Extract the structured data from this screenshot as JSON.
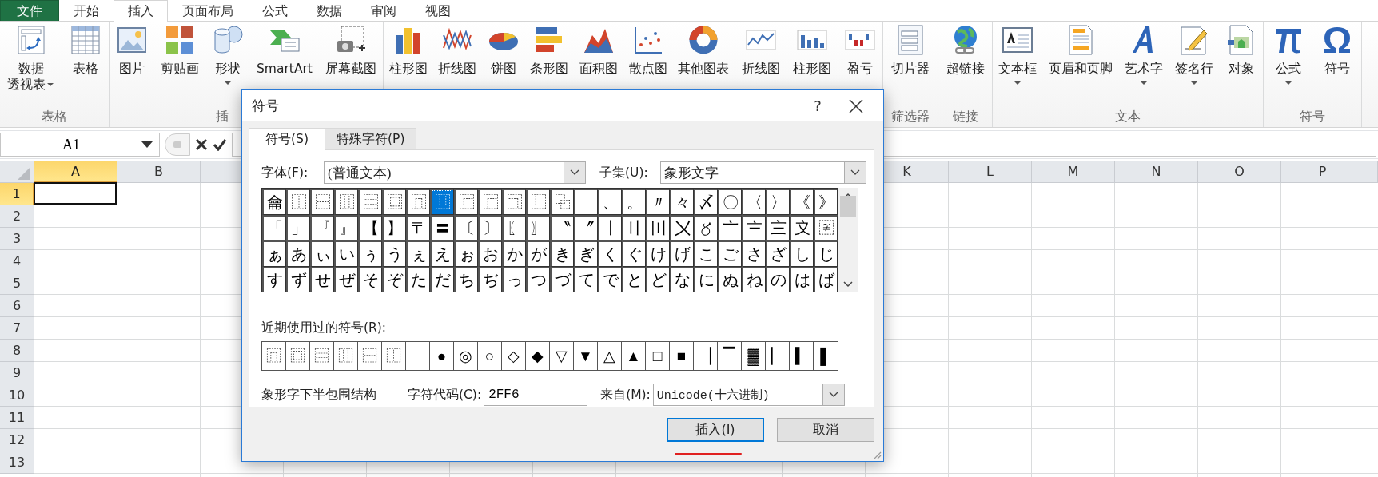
{
  "menu_tabs": [
    {
      "label": "文件",
      "kind": "file",
      "selected": false
    },
    {
      "label": "开始",
      "kind": "tab",
      "selected": false
    },
    {
      "label": "插入",
      "kind": "tab",
      "selected": true
    },
    {
      "label": "页面布局",
      "kind": "tab",
      "selected": false
    },
    {
      "label": "公式",
      "kind": "tab",
      "selected": false
    },
    {
      "label": "数据",
      "kind": "tab",
      "selected": false
    },
    {
      "label": "审阅",
      "kind": "tab",
      "selected": false
    },
    {
      "label": "视图",
      "kind": "tab",
      "selected": false
    }
  ],
  "ribbon": {
    "groups": [
      {
        "label": "表格",
        "buttons": [
          {
            "lines": [
              "数据",
              "透视表"
            ],
            "dropdown": true
          },
          {
            "label": "表格",
            "dropdown": false
          }
        ]
      },
      {
        "label": "插",
        "buttons": [
          {
            "label": "图片",
            "dropdown": false
          },
          {
            "label": "剪贴画",
            "dropdown": false
          },
          {
            "label": "形状",
            "dropdown": true
          },
          {
            "label": "SmartArt",
            "dropdown": false
          },
          {
            "label": "屏幕截图",
            "dropdown": false
          }
        ]
      },
      {
        "buttons": [
          {
            "label": "柱形图",
            "dropdown": false
          },
          {
            "label": "折线图",
            "dropdown": false
          },
          {
            "label": "饼图",
            "dropdown": false
          },
          {
            "label": "条形图",
            "dropdown": false
          },
          {
            "label": "面积图",
            "dropdown": false
          },
          {
            "label": "散点图",
            "dropdown": false
          },
          {
            "label": "其他图表",
            "dropdown": false
          }
        ]
      },
      {
        "buttons": [
          {
            "label": "折线图",
            "dropdown": false
          },
          {
            "label": "柱形图",
            "dropdown": false
          },
          {
            "label": "盈亏",
            "dropdown": false
          }
        ]
      },
      {
        "label": "筛选器",
        "buttons": [
          {
            "label": "切片器",
            "dropdown": false
          }
        ]
      },
      {
        "label": "链接",
        "buttons": [
          {
            "label": "超链接",
            "dropdown": false
          }
        ]
      },
      {
        "label": "文本",
        "buttons": [
          {
            "label": "文本框",
            "dropdown": true
          },
          {
            "label": "页眉和页脚",
            "dropdown": false
          },
          {
            "label": "艺术字",
            "dropdown": true
          },
          {
            "label": "签名行",
            "dropdown": true
          },
          {
            "label": "对象",
            "dropdown": false
          }
        ]
      },
      {
        "label": "符号",
        "buttons": [
          {
            "label": "公式",
            "dropdown": true
          },
          {
            "label": "符号",
            "dropdown": false
          }
        ]
      }
    ]
  },
  "formula_bar": {
    "name_box": "A1"
  },
  "sheet": {
    "columns": [
      {
        "label": "A",
        "selected": true
      },
      {
        "label": "B",
        "selected": false
      },
      {
        "label": "K",
        "selected": false
      },
      {
        "label": "L",
        "selected": false
      },
      {
        "label": "M",
        "selected": false
      },
      {
        "label": "N",
        "selected": false
      },
      {
        "label": "O",
        "selected": false
      },
      {
        "label": "P",
        "selected": false
      }
    ],
    "rows": [
      {
        "label": "1",
        "selected": true
      },
      {
        "label": "2",
        "selected": false
      },
      {
        "label": "3",
        "selected": false
      },
      {
        "label": "4",
        "selected": false
      },
      {
        "label": "5",
        "selected": false
      },
      {
        "label": "6",
        "selected": false
      },
      {
        "label": "7",
        "selected": false
      },
      {
        "label": "8",
        "selected": false
      },
      {
        "label": "9",
        "selected": false
      },
      {
        "label": "10",
        "selected": false
      },
      {
        "label": "11",
        "selected": false
      },
      {
        "label": "12",
        "selected": false
      },
      {
        "label": "13",
        "selected": false
      }
    ]
  },
  "dialog": {
    "title": "符号",
    "help": "?",
    "tabs": [
      {
        "label": "符号(S)",
        "selected": true
      },
      {
        "label": "特殊字符(P)",
        "selected": false
      }
    ],
    "font_label": "字体(F):",
    "font_value": "(普通文本)",
    "subset_label": "子集(U):",
    "subset_value": "象形文字",
    "symbols": [
      [
        {
          "c": "⿕",
          "selected": false
        },
        {
          "c": "⿰",
          "selected": false
        },
        {
          "c": "⿱",
          "selected": false
        },
        {
          "c": "⿲",
          "selected": false
        },
        {
          "c": "⿳",
          "selected": false
        },
        {
          "c": "⿴",
          "selected": false
        },
        {
          "c": "⿵",
          "selected": false
        },
        {
          "c": "⿶",
          "selected": true
        },
        {
          "c": "⿷",
          "selected": false
        },
        {
          "c": "⿸",
          "selected": false
        },
        {
          "c": "⿹",
          "selected": false
        },
        {
          "c": "⿺",
          "selected": false
        },
        {
          "c": "⿻",
          "selected": false
        },
        {
          "selected": false
        },
        {
          "c": "、",
          "selected": false
        },
        {
          "c": "。",
          "selected": false
        },
        {
          "c": "〃",
          "selected": false
        },
        {
          "c": "々",
          "selected": false
        },
        {
          "c": "〆",
          "selected": false
        },
        {
          "c": "〇",
          "selected": false
        },
        {
          "c": "〈",
          "selected": false
        },
        {
          "c": "〉",
          "selected": false
        },
        {
          "c": "《",
          "selected": false
        },
        {
          "c": "》",
          "selected": false
        }
      ],
      [
        {
          "c": "「",
          "selected": false
        },
        {
          "c": "」",
          "selected": false
        },
        {
          "c": "『",
          "selected": false
        },
        {
          "c": "』",
          "selected": false
        },
        {
          "c": "【",
          "selected": false
        },
        {
          "c": "】",
          "selected": false
        },
        {
          "c": "〒",
          "selected": false
        },
        {
          "c": "〓",
          "selected": false
        },
        {
          "c": "〔",
          "selected": false
        },
        {
          "c": "〕",
          "selected": false
        },
        {
          "c": "〖",
          "selected": false
        },
        {
          "c": "〗",
          "selected": false
        },
        {
          "c": "〝",
          "selected": false
        },
        {
          "c": "〞",
          "selected": false
        },
        {
          "c": "〡",
          "selected": false
        },
        {
          "c": "〢",
          "selected": false
        },
        {
          "c": "〣",
          "selected": false
        },
        {
          "c": "〤",
          "selected": false
        },
        {
          "c": "〥",
          "selected": false
        },
        {
          "c": "〦",
          "selected": false
        },
        {
          "c": "〧",
          "selected": false
        },
        {
          "c": "〨",
          "selected": false
        },
        {
          "c": "〩",
          "selected": false
        },
        {
          "c": "〾",
          "selected": false
        }
      ],
      [
        {
          "c": "ぁ",
          "selected": false
        },
        {
          "c": "あ",
          "selected": false
        },
        {
          "c": "ぃ",
          "selected": false
        },
        {
          "c": "い",
          "selected": false
        },
        {
          "c": "ぅ",
          "selected": false
        },
        {
          "c": "う",
          "selected": false
        },
        {
          "c": "ぇ",
          "selected": false
        },
        {
          "c": "え",
          "selected": false
        },
        {
          "c": "ぉ",
          "selected": false
        },
        {
          "c": "お",
          "selected": false
        },
        {
          "c": "か",
          "selected": false
        },
        {
          "c": "が",
          "selected": false
        },
        {
          "c": "き",
          "selected": false
        },
        {
          "c": "ぎ",
          "selected": false
        },
        {
          "c": "く",
          "selected": false
        },
        {
          "c": "ぐ",
          "selected": false
        },
        {
          "c": "け",
          "selected": false
        },
        {
          "c": "げ",
          "selected": false
        },
        {
          "c": "こ",
          "selected": false
        },
        {
          "c": "ご",
          "selected": false
        },
        {
          "c": "さ",
          "selected": false
        },
        {
          "c": "ざ",
          "selected": false
        },
        {
          "c": "し",
          "selected": false
        },
        {
          "c": "じ",
          "selected": false
        }
      ],
      [
        {
          "c": "す",
          "selected": false
        },
        {
          "c": "ず",
          "selected": false
        },
        {
          "c": "せ",
          "selected": false
        },
        {
          "c": "ぜ",
          "selected": false
        },
        {
          "c": "そ",
          "selected": false
        },
        {
          "c": "ぞ",
          "selected": false
        },
        {
          "c": "た",
          "selected": false
        },
        {
          "c": "だ",
          "selected": false
        },
        {
          "c": "ち",
          "selected": false
        },
        {
          "c": "ぢ",
          "selected": false
        },
        {
          "c": "っ",
          "selected": false
        },
        {
          "c": "つ",
          "selected": false
        },
        {
          "c": "づ",
          "selected": false
        },
        {
          "c": "て",
          "selected": false
        },
        {
          "c": "で",
          "selected": false
        },
        {
          "c": "と",
          "selected": false
        },
        {
          "c": "ど",
          "selected": false
        },
        {
          "c": "な",
          "selected": false
        },
        {
          "c": "に",
          "selected": false
        },
        {
          "c": "ぬ",
          "selected": false
        },
        {
          "c": "ね",
          "selected": false
        },
        {
          "c": "の",
          "selected": false
        },
        {
          "c": "は",
          "selected": false
        },
        {
          "c": "ば",
          "selected": false
        }
      ]
    ],
    "recent_label": "近期使用过的符号(R):",
    "recent": [
      {
        "kind": "symbol",
        "c": "⿵"
      },
      {
        "kind": "symbol",
        "c": "⿴"
      },
      {
        "kind": "symbol",
        "c": "⿳"
      },
      {
        "kind": "symbol",
        "c": "⿲"
      },
      {
        "kind": "symbol",
        "c": "⿱"
      },
      {
        "kind": "symbol",
        "c": "⿰"
      },
      {
        "kind": "blank"
      },
      {
        "kind": "symbol",
        "c": "●"
      },
      {
        "kind": "symbol",
        "c": "◎"
      },
      {
        "kind": "symbol",
        "c": "○"
      },
      {
        "kind": "symbol",
        "c": "◇"
      },
      {
        "kind": "symbol",
        "c": "◆"
      },
      {
        "kind": "symbol",
        "c": "▽"
      },
      {
        "kind": "symbol",
        "c": "▼"
      },
      {
        "kind": "symbol",
        "c": "△"
      },
      {
        "kind": "symbol",
        "c": "▲"
      },
      {
        "kind": "symbol",
        "c": "□"
      },
      {
        "kind": "symbol",
        "c": "■"
      },
      {
        "kind": "symbol",
        "c": "▕"
      },
      {
        "kind": "symbol",
        "c": "▔"
      },
      {
        "kind": "symbol",
        "c": "▓"
      },
      {
        "kind": "symbol",
        "c": "▏"
      },
      {
        "kind": "symbol",
        "c": "▍"
      },
      {
        "kind": "symbol",
        "c": "▌"
      }
    ],
    "char_name": "象形字下半包围结构",
    "code_label": "字符代码(C):",
    "code_value": "2FF6",
    "from_label": "来自(M):",
    "from_value": "Unicode(十六进制)",
    "buttons": [
      {
        "label": "插入(I)",
        "kind": "default"
      },
      {
        "label": "取消",
        "kind": "normal"
      }
    ]
  }
}
